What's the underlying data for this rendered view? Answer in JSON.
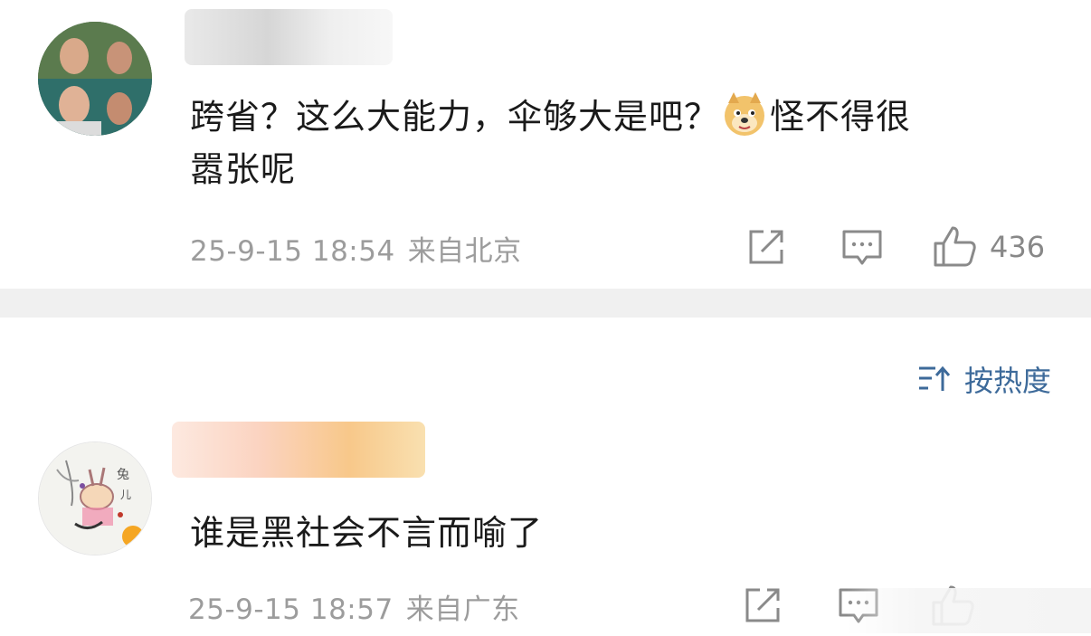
{
  "comments": [
    {
      "text_line1_a": "跨省？这么大能力，伞够大是吧？",
      "emoji": "doge-emoji",
      "text_line1_b": "怪不得很",
      "text_line2": "嚣张呢",
      "time": "25-9-15 18:54",
      "location": "来自北京",
      "likes": "436"
    },
    {
      "text": "谁是黑社会不言而喻了",
      "time": "25-9-15 18:57",
      "location": "来自广东"
    }
  ],
  "sort": {
    "label": "按热度",
    "icon": "sort-icon"
  },
  "colors": {
    "meta": "#9c9c9c",
    "divider": "#f0f0f0",
    "sort": "#3d6a9a"
  }
}
